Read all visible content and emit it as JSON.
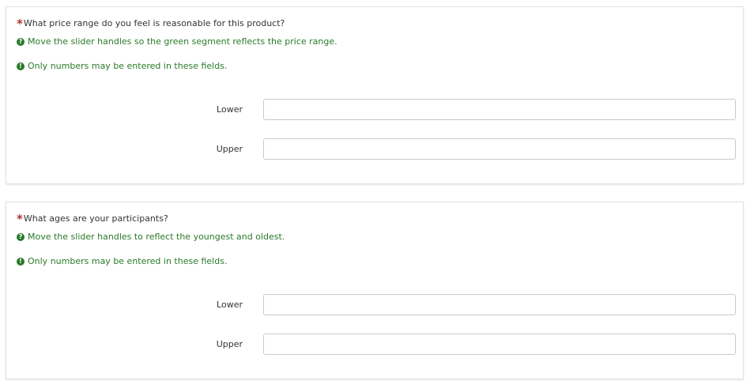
{
  "questions": [
    {
      "mandatory_mark": "*",
      "title": "What price range do you feel is reasonable for this product?",
      "tip_icon": "?",
      "tip": "Move the slider handles so the green segment reflects the price range.",
      "warn_icon": "!",
      "warning": "Only numbers may be entered in these fields.",
      "lower": {
        "label": "Lower",
        "value": ""
      },
      "upper": {
        "label": "Upper",
        "value": ""
      }
    },
    {
      "mandatory_mark": "*",
      "title": "What ages are your participants?",
      "tip_icon": "?",
      "tip": "Move the slider handles to reflect the youngest and oldest.",
      "warn_icon": "!",
      "warning": "Only numbers may be entered in these fields.",
      "lower": {
        "label": "Lower",
        "value": ""
      },
      "upper": {
        "label": "Upper",
        "value": ""
      }
    }
  ],
  "colors": {
    "mandatory": "#b0332e",
    "help_text": "#2a7a2a",
    "label_text": "#333333",
    "input_border": "#c9c9c9"
  },
  "icons": {
    "tip": "question-circle-icon",
    "warning": "exclamation-circle-icon"
  }
}
